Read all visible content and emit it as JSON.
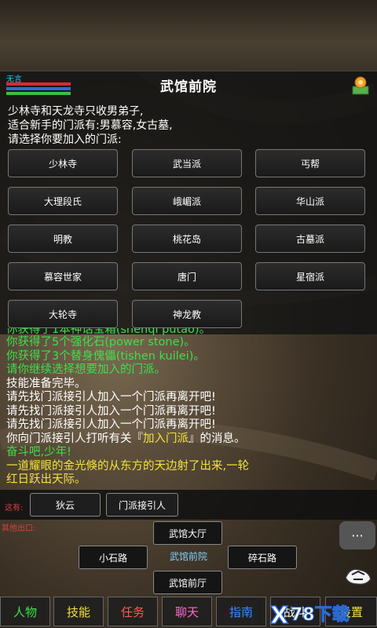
{
  "player": {
    "name": "无言"
  },
  "room": {
    "title": "武馆前院",
    "description": [
      "少林寺和天龙寺只收男弟子,",
      "适合新手的门派有:男慕容,女古墓,",
      "请选择你要加入的门派:"
    ]
  },
  "sects": [
    "少林寺",
    "武当派",
    "丐帮",
    "大理段氏",
    "峨嵋派",
    "华山派",
    "明教",
    "桃花岛",
    "古墓派",
    "慕容世家",
    "唐门",
    "星宿派",
    "大轮寺",
    "神龙教"
  ],
  "log": [
    {
      "text": "你获得了1本神话宝箱(shenqi putao)。",
      "color": "green"
    },
    {
      "text": "你获得了5个强化石(power stone)。",
      "color": "green"
    },
    {
      "text": "你获得了3个替身傀儡(tishen kuilei)。",
      "color": "green"
    },
    {
      "text": "请你继续选择想要加入的门派。",
      "color": "green"
    },
    {
      "text": "技能准备完毕。",
      "color": "white"
    },
    {
      "text": "请先找门派接引人加入一个门派再离开吧!",
      "color": "white"
    },
    {
      "text": "请先找门派接引人加入一个门派再离开吧!",
      "color": "white"
    },
    {
      "text": "请先找门派接引人加入一个门派再离开吧!",
      "color": "white"
    },
    {
      "text_before": "你向门派接引人打听有关『",
      "highlight": "加入门派",
      "text_after": "』的消息。",
      "color": "white"
    },
    {
      "text": "奋斗吧,少年!",
      "color": "green"
    },
    {
      "text": "一道耀眼的金光倏的从东方的天边射了出来,一轮",
      "color": "yellow"
    },
    {
      "text": "红日跃出天际。",
      "color": "yellow"
    }
  ],
  "here": {
    "label": "这有:",
    "npcs": [
      "狄云",
      "门派接引人"
    ]
  },
  "exits": {
    "label": "其他出口:",
    "north": "武馆大厅",
    "west": "小石路",
    "current": "武馆前院",
    "east": "碎石路",
    "south": "武馆前厅"
  },
  "more_label": "···",
  "tabs": [
    {
      "label": "人物",
      "color": "#3ce04a"
    },
    {
      "label": "技能",
      "color": "#f2e23c"
    },
    {
      "label": "任务",
      "color": "#ff5a4a"
    },
    {
      "label": "聊天",
      "color": "#ff66cc"
    },
    {
      "label": "指南",
      "color": "#3a8cff"
    },
    {
      "label": "战斗",
      "color": "#ffffff"
    },
    {
      "label": "设置",
      "color": "#f2e23c"
    }
  ],
  "watermark": "X78下载"
}
